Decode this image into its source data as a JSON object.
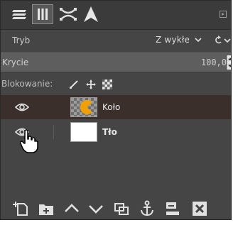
{
  "tabs": [
    {
      "icon": "layers-stack-icon",
      "active": false
    },
    {
      "icon": "channels-icon",
      "active": true
    },
    {
      "icon": "paths-icon",
      "active": false
    },
    {
      "icon": "undo-history-icon",
      "active": false
    }
  ],
  "mode": {
    "label": "Tryb",
    "value": "Z wykłe"
  },
  "opacity": {
    "label": "Krycie",
    "value": "100,0"
  },
  "lock": {
    "label": "Blokowanie:"
  },
  "layers": [
    {
      "name": "Koło",
      "visible": true,
      "selected": true,
      "bold": false
    },
    {
      "name": "Tło",
      "visible": true,
      "selected": false,
      "bold": true
    }
  ],
  "colors": {
    "panel": "#454545",
    "selected_row": "#3a2f2a",
    "slider": "#5e5e5e"
  }
}
